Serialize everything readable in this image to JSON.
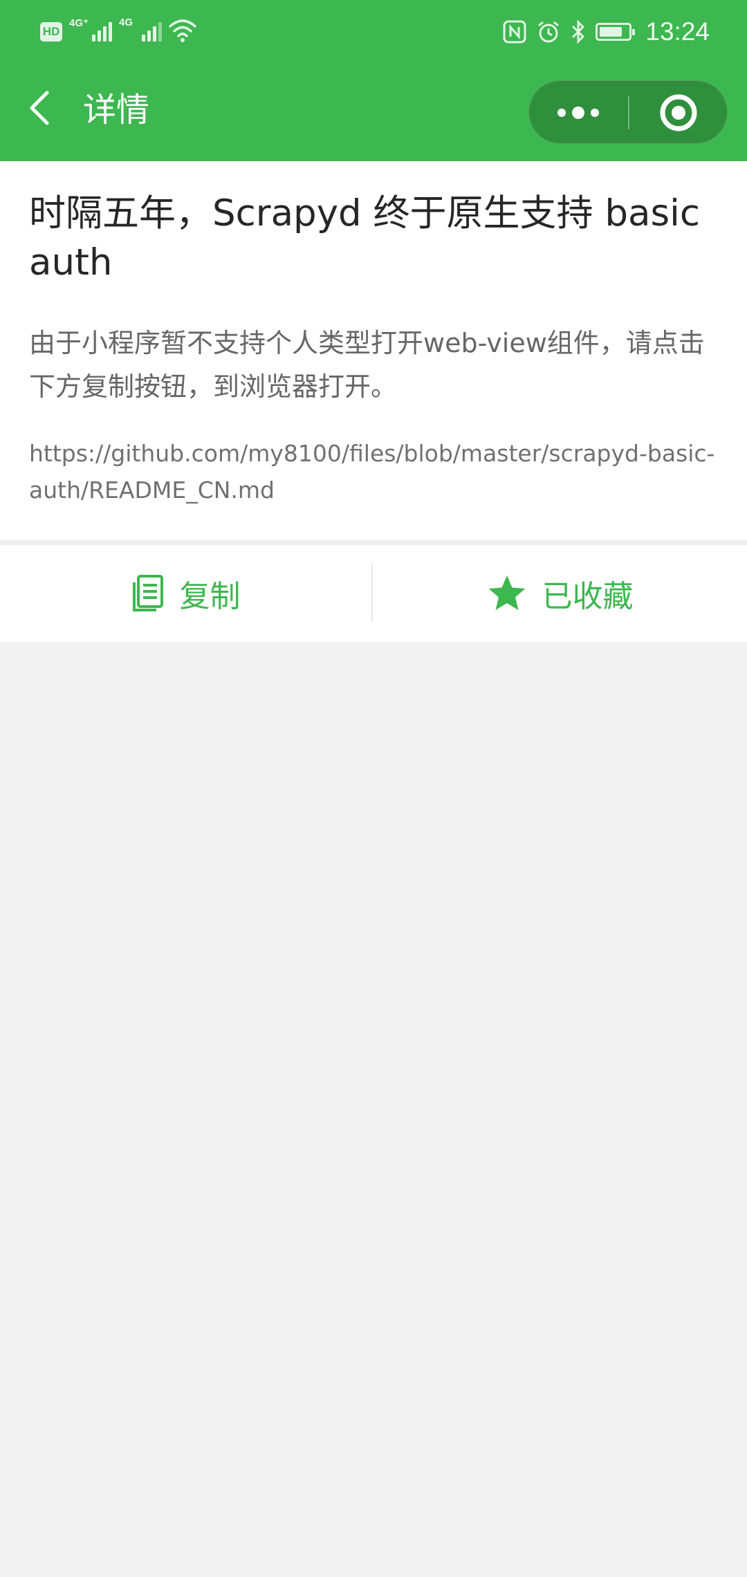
{
  "status_bar": {
    "hd_label": "HD",
    "sim1_tag": "4G⁺",
    "sim2_tag": "4G",
    "time": "13:24",
    "icons": [
      "nfc-icon",
      "alarm-icon",
      "bluetooth-icon",
      "battery-icon"
    ]
  },
  "nav": {
    "back_icon": "chevron-left-icon",
    "title": "详情",
    "more_icon": "more-dots-icon",
    "close_icon": "target-circle-icon"
  },
  "article": {
    "title": "时隔五年，Scrapyd 终于原生支持 basic auth",
    "notice": "由于小程序暂不支持个人类型打开web-view组件，请点击下方复制按钮，到浏览器打开。",
    "url": "https://github.com/my8100/files/blob/master/scrapyd-basic-auth/README_CN.md"
  },
  "actions": {
    "copy_label": "复制",
    "copy_icon": "document-copy-icon",
    "favorite_label": "已收藏",
    "favorite_icon": "star-filled-icon"
  },
  "colors": {
    "brand_green": "#3db74f",
    "capsule_green": "#2f8f3d",
    "background": "#f3f3f3"
  }
}
